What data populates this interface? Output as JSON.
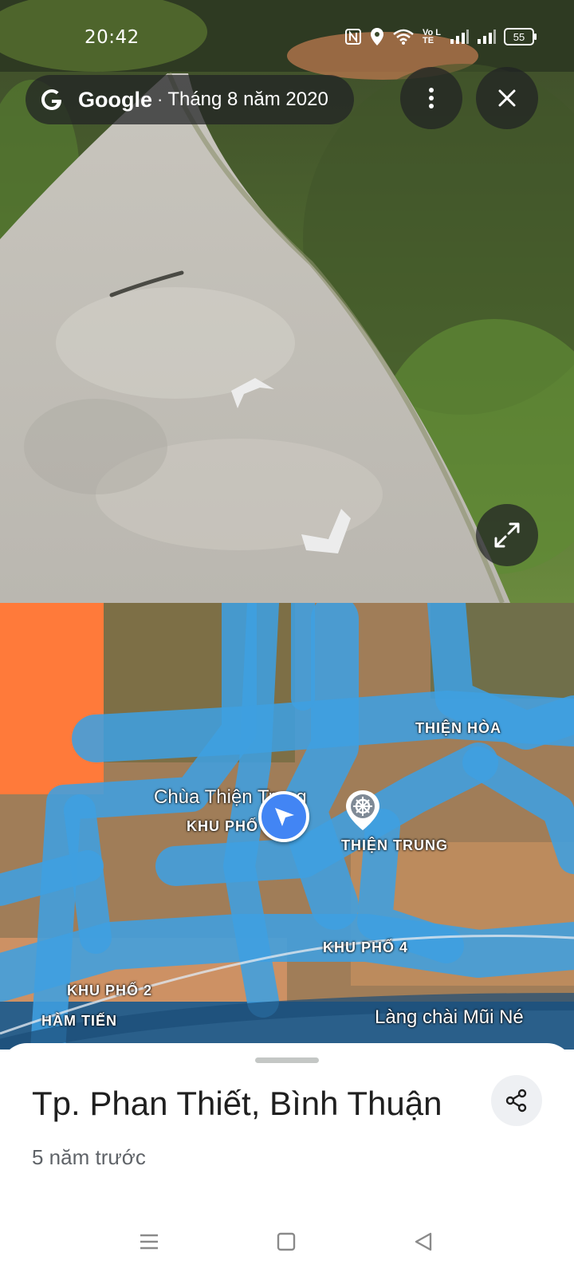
{
  "status_bar": {
    "time": "20:42",
    "battery": "55",
    "volte_label": "Vo LTE",
    "icons": [
      "nfc-icon",
      "location-icon",
      "wifi-icon",
      "volte-icon",
      "signal-icon",
      "signal-icon",
      "battery-icon"
    ]
  },
  "streetview": {
    "brand": "Google",
    "separator": "·",
    "capture_date": "Tháng 8 năm 2020",
    "buttons": [
      "more-options-icon",
      "close-icon",
      "expand-icon"
    ]
  },
  "map": {
    "labels": {
      "thien_hoa": "THIỆN HÒA",
      "chua": "Chùa Thiện Trung",
      "khu_pho_3": "KHU PHỐ 3",
      "thien_trung": "THIỆN TRUNG",
      "khu_pho_4": "KHU PHỐ 4",
      "khu_pho_2": "KHU PHỐ 2",
      "ham_tien": "HÀM TIẾN",
      "lang_chai": "Làng chài Mũi Né"
    },
    "colors": {
      "coverage": "#3f9fe0",
      "marker": "#4285f4"
    }
  },
  "sheet": {
    "place_name": "Tp. Phan Thiết, Bình Thuận",
    "time_ago": "5 năm trước"
  },
  "nav": [
    "recents-icon",
    "home-icon",
    "back-icon"
  ]
}
